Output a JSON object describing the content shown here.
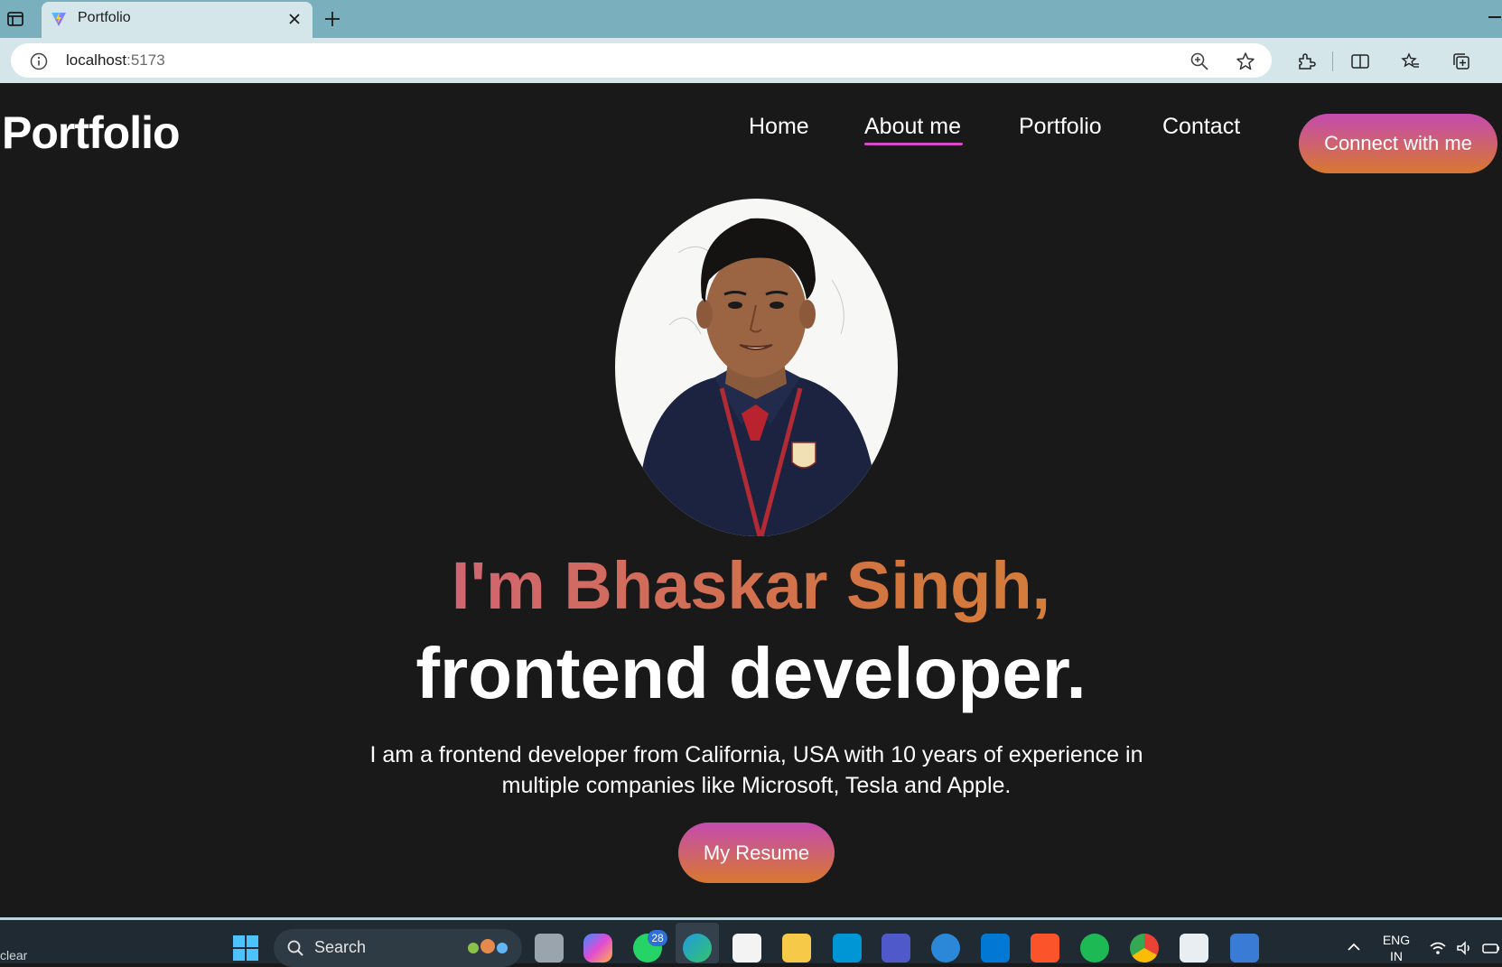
{
  "browser": {
    "tab_title": "Portfolio",
    "url_host": "localhost",
    "url_port": ":5173"
  },
  "site": {
    "logo": "Portfolio",
    "nav": [
      {
        "label": "Home"
      },
      {
        "label": "About me",
        "active": true
      },
      {
        "label": "Portfolio"
      },
      {
        "label": "Contact"
      }
    ],
    "connect_button": "Connect with me"
  },
  "hero": {
    "name_line": "I'm Bhaskar Singh,",
    "role_line": "frontend developer.",
    "description": "I am a frontend developer from California, USA with 10 years of experience in multiple companies like Microsoft, Tesla and Apple.",
    "resume_button": "My Resume"
  },
  "taskbar": {
    "status_left": "clear",
    "search_placeholder": "Search",
    "whatsapp_badge": "28",
    "lang_line1": "ENG",
    "lang_line2": "IN"
  },
  "colors": {
    "accent_pink": "#c44bb0",
    "accent_orange": "#d8782f",
    "page_bg": "#191919"
  },
  "icons": [
    "tab-actions-icon",
    "vite-favicon-icon",
    "close-icon",
    "plus-icon",
    "info-icon",
    "zoom-icon",
    "star-icon",
    "extensions-icon",
    "split-screen-icon",
    "favorites-icon",
    "collections-icon",
    "windows-start-icon",
    "search-icon"
  ]
}
